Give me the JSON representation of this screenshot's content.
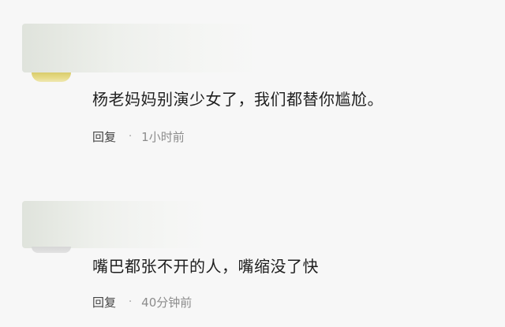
{
  "comments": [
    {
      "text": "杨老妈妈别演少女了，我们都替你尴尬。",
      "reply_label": "回复",
      "separator": "·",
      "time": "1小时前"
    },
    {
      "text": "嘴巴都张不开的人，嘴缩没了快",
      "reply_label": "回复",
      "separator": "·",
      "time": "40分钟前"
    }
  ]
}
